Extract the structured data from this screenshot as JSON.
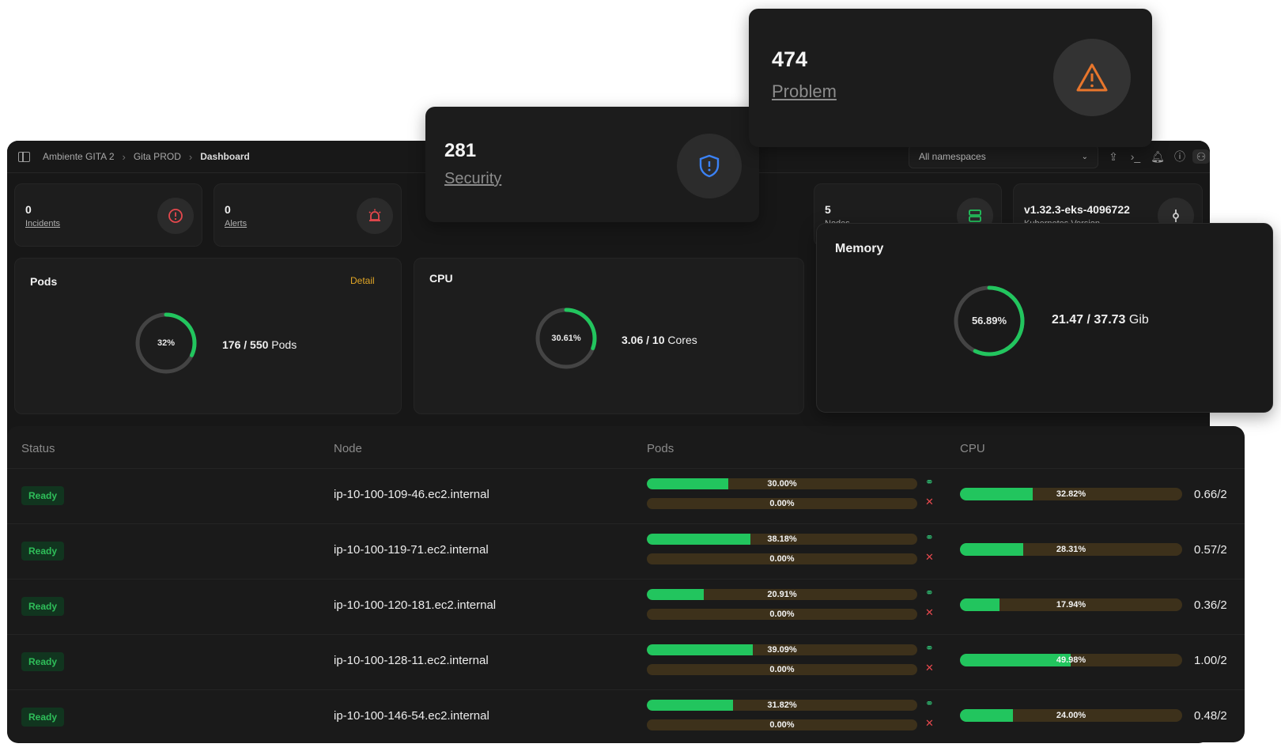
{
  "breadcrumb": [
    "Ambiente GITA 2",
    "Gita PROD",
    "Dashboard"
  ],
  "namespace_select": "All namespaces",
  "stats": {
    "incidents": {
      "value": "0",
      "label": "Incidents"
    },
    "alerts": {
      "value": "0",
      "label": "Alerts"
    },
    "nodes": {
      "value": "5",
      "label": "Nodes"
    },
    "k8s": {
      "value": "v1.32.3-eks-4096722",
      "label": "Kubernetes Version"
    }
  },
  "problem": {
    "value": "474",
    "label": "Problem"
  },
  "security": {
    "value": "281",
    "label": "Security"
  },
  "pods_panel": {
    "title": "Pods",
    "detail": "Detail",
    "percent_label": "32%",
    "used": "176",
    "total": "550",
    "unit": "Pods",
    "percent": 32
  },
  "cpu_panel": {
    "title": "CPU",
    "percent_label": "30.61%",
    "used": "3.06",
    "total": "10",
    "unit": "Cores",
    "percent": 30.61
  },
  "memory_panel": {
    "title": "Memory",
    "percent_label": "56.89%",
    "used": "21.47",
    "total": "37.73",
    "unit": "Gib",
    "percent": 56.89
  },
  "table": {
    "headers": [
      "Status",
      "Node",
      "Pods",
      "CPU"
    ],
    "rows": [
      {
        "status": "Ready",
        "node": "ip-10-100-109-46.ec2.internal",
        "pods_pct": 30.0,
        "pods_label": "30.00%",
        "err_label": "0.00%",
        "cpu_pct": 32.82,
        "cpu_label": "32.82%",
        "cpu_value": "0.66/2"
      },
      {
        "status": "Ready",
        "node": "ip-10-100-119-71.ec2.internal",
        "pods_pct": 38.18,
        "pods_label": "38.18%",
        "err_label": "0.00%",
        "cpu_pct": 28.31,
        "cpu_label": "28.31%",
        "cpu_value": "0.57/2"
      },
      {
        "status": "Ready",
        "node": "ip-10-100-120-181.ec2.internal",
        "pods_pct": 20.91,
        "pods_label": "20.91%",
        "err_label": "0.00%",
        "cpu_pct": 17.94,
        "cpu_label": "17.94%",
        "cpu_value": "0.36/2"
      },
      {
        "status": "Ready",
        "node": "ip-10-100-128-11.ec2.internal",
        "pods_pct": 39.09,
        "pods_label": "39.09%",
        "err_label": "0.00%",
        "cpu_pct": 49.98,
        "cpu_label": "49.98%",
        "cpu_value": "1.00/2"
      },
      {
        "status": "Ready",
        "node": "ip-10-100-146-54.ec2.internal",
        "pods_pct": 31.82,
        "pods_label": "31.82%",
        "err_label": "0.00%",
        "cpu_pct": 24.0,
        "cpu_label": "24.00%",
        "cpu_value": "0.48/2"
      }
    ]
  },
  "colors": {
    "green": "#22c55e",
    "amber_track": "#3d311b",
    "detail": "#e0a526",
    "problem_icon": "#e8762c",
    "security_icon": "#3b82f6",
    "alert_icon": "#e5484d"
  }
}
